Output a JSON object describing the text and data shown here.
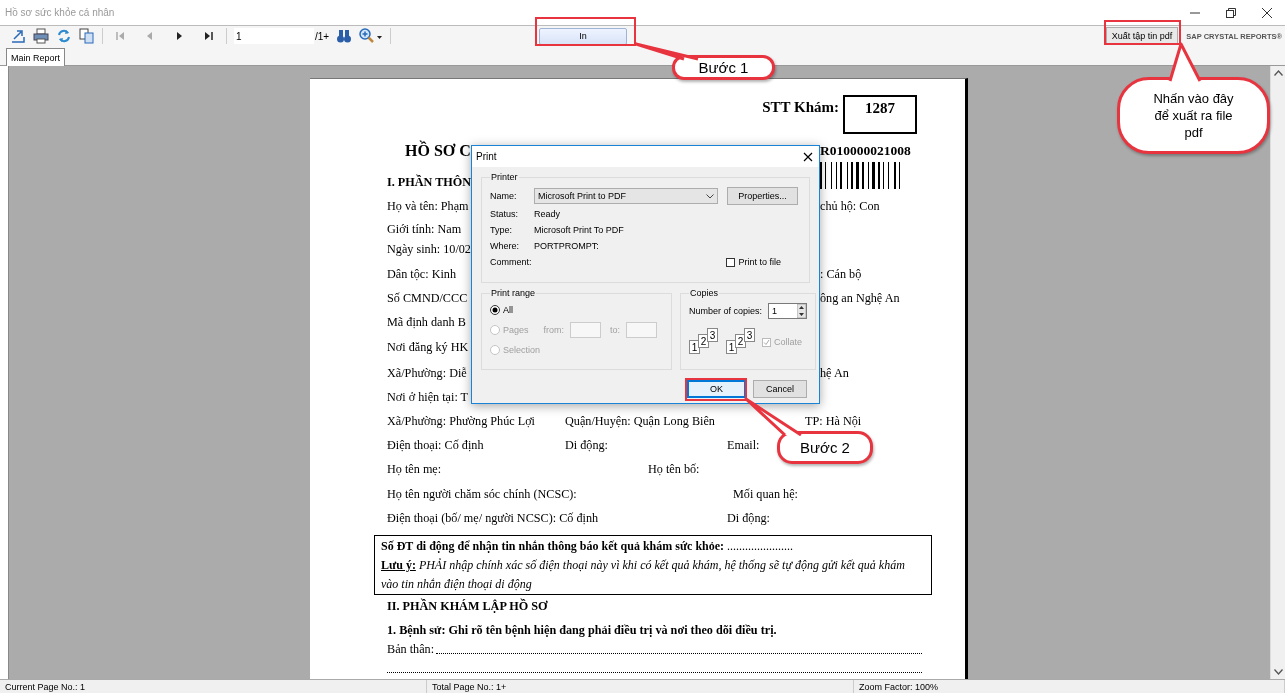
{
  "window": {
    "title": "Hồ sơ sức khỏe cá nhân"
  },
  "toolbar": {
    "page_field": {
      "value": "1"
    },
    "page_total": "/1+",
    "print_button": "In",
    "export_button": "Xuất tập tin pdf",
    "brand": "SAP CRYSTAL REPORTS®"
  },
  "tabs": [
    {
      "label": "Main Report",
      "selected": true
    }
  ],
  "document": {
    "stt_label": "STT Khám:",
    "stt_value": "1287",
    "rows": [
      {
        "kind": "title",
        "cells": [
          "HỒ SƠ C",
          "R010000021008"
        ]
      },
      {
        "kind": "heading",
        "cells": [
          "I. PHẦN THÔN"
        ]
      },
      {
        "kind": "line",
        "cells": [
          "Họ và tên: Phạm",
          "chủ hộ: Con"
        ]
      },
      {
        "kind": "line",
        "cells": [
          "Giới tính: Nam"
        ]
      },
      {
        "kind": "line",
        "cells": [
          "Ngày sinh: 10/02"
        ]
      },
      {
        "kind": "line",
        "cells": [
          "Dân tộc: Kinh",
          ": Cán bộ"
        ]
      },
      {
        "kind": "line",
        "cells": [
          "Số CMND/CCC",
          "ông an Nghệ An"
        ]
      },
      {
        "kind": "line",
        "cells": [
          "Mã định danh B"
        ]
      },
      {
        "kind": "line",
        "cells": [
          "Nơi đăng ký HK"
        ]
      },
      {
        "kind": "line",
        "cells": [
          "Xã/Phường: Diễ",
          "hệ An"
        ]
      },
      {
        "kind": "line",
        "cells": [
          "Nơi ở hiện tại: T"
        ]
      },
      {
        "kind": "line",
        "cells": [
          "Xã/Phường: Phường Phúc Lợi",
          "Quận/Huyện: Quận Long Biên",
          "TP: Hà Nội"
        ]
      },
      {
        "kind": "line",
        "cells": [
          "Điện thoại: Cố định",
          "Di động:",
          "Email:"
        ]
      },
      {
        "kind": "line",
        "cells": [
          "Họ tên mẹ:",
          "Họ tên bố:"
        ]
      },
      {
        "kind": "line",
        "cells": [
          "Họ tên người chăm sóc chính (NCSC):",
          "Mối quan hệ:"
        ]
      },
      {
        "kind": "line",
        "cells": [
          "Điện thoại (bố/ mẹ/ người NCSC): Cố định",
          "Di động:"
        ]
      }
    ],
    "notice": [
      "**Số ĐT di động để nhận tin nhắn thông báo kết quả khám sức khỏe:** ......................",
      "**Lưu ý:** *PHẢI nhập chính xác số điện thoại này vì khi có kết quả khám, hệ thống sẽ tự động gửi kết quả khám vào tin nhắn điện thoại di động*"
    ],
    "section": "II. PHẦN KHÁM LẬP HỒ SƠ",
    "question": "1. Bệnh sử: Ghi rõ tên bệnh hiện đang phải điều trị và nơi theo dõi điều trị.",
    "answer_label": "Bản thân:"
  },
  "print_dialog": {
    "title": "Print",
    "printer": {
      "legend": "Printer",
      "name_label": "Name:",
      "name_value": "Microsoft Print to PDF",
      "properties": "Properties...",
      "info": [
        {
          "label": "Status:",
          "value": "Ready"
        },
        {
          "label": "Type:",
          "value": "Microsoft Print To PDF"
        },
        {
          "label": "Where:",
          "value": "PORTPROMPT:"
        },
        {
          "label": "Comment:"
        }
      ],
      "print_to_file": {
        "label": "Print to file",
        "checked": false
      }
    },
    "print_range": {
      "legend": "Print range",
      "from_label": "from:",
      "to_label": "to:",
      "options": [
        {
          "label": "All",
          "selected": true,
          "disabled": false
        },
        {
          "label": "Pages",
          "selected": false,
          "disabled": true
        },
        {
          "label": "Selection",
          "selected": false,
          "disabled": true
        }
      ]
    },
    "copies": {
      "legend": "Copies",
      "label": "Number of copies:",
      "value": "1",
      "collate_stacks": [
        {
          "pages": [
            "1",
            "2",
            "3"
          ]
        },
        {
          "pages": [
            "1",
            "2",
            "3"
          ]
        }
      ],
      "collate": {
        "label": "Collate",
        "checked": true,
        "disabled": true
      }
    },
    "buttons": [
      {
        "label": "OK",
        "focused": true
      },
      {
        "label": "Cancel",
        "focused": false
      }
    ]
  },
  "callouts": [
    {
      "text": "Bước 1"
    },
    {
      "text": "Nhấn vào đây để xuất ra file pdf"
    },
    {
      "text": "Bước 2"
    }
  ],
  "status_bar": [
    "Current Page No.: 1",
    "Total Page No.: 1+",
    "Zoom Factor: 100%"
  ]
}
